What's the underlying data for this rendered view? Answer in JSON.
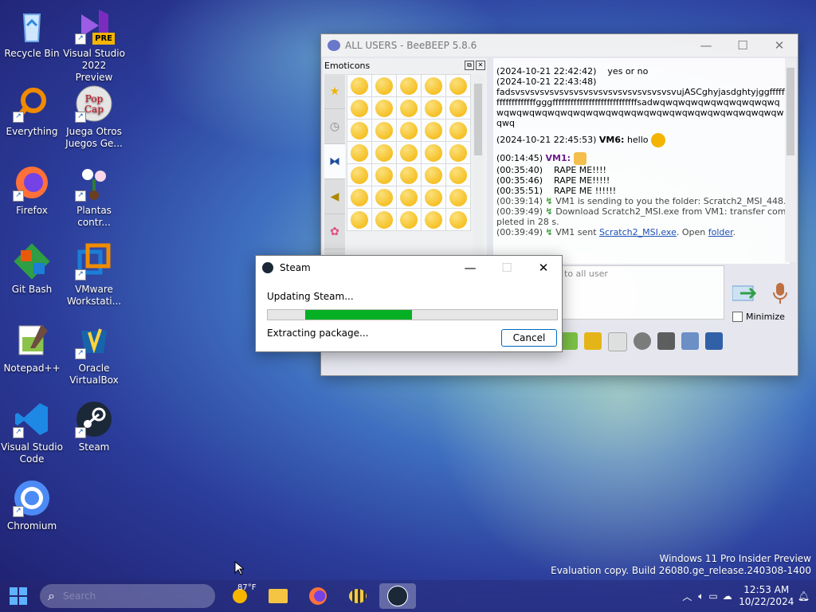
{
  "desktop": {
    "icons": [
      {
        "label": "Recycle Bin"
      },
      {
        "label": "Visual Studio 2022 Preview",
        "badge": "PRE"
      },
      {
        "label": "Everything"
      },
      {
        "label": "Juega Otros Juegos Ge..."
      },
      {
        "label": "Firefox"
      },
      {
        "label": "Plantas contr..."
      },
      {
        "label": "Git Bash"
      },
      {
        "label": "VMware Workstati..."
      },
      {
        "label": "Notepad++"
      },
      {
        "label": "Oracle VirtualBox"
      },
      {
        "label": "Visual Studio Code"
      },
      {
        "label": "Steam"
      },
      {
        "label": "Chromium"
      }
    ]
  },
  "beebeep": {
    "title": "ALL USERS - BeeBEEP 5.8.6",
    "emoticons_title": "Emoticons",
    "chat": [
      {
        "time": "(2024-10-21 22:42:42)",
        "text": "yes or no"
      },
      {
        "time": "(2024-10-21 22:43:48)",
        "text": "fadsvsvsvsvsvsvsvsvsvsvsvsvsvsvsvsvsvujASCghyjasdghtyjggffffffffffffffffffgggffffffffffffffffffffffffffffsadwqwqwqwqwqwqwqwqwqwqwqwqwqwqwqwqwqwqwqwqwqwqwqwqwqwqwqwqwqwqwqwqwqwq"
      },
      {
        "time": "(2024-10-21 22:45:53)",
        "user": "VM6:",
        "text": "hello"
      },
      {
        "time": "(00:14:45)",
        "user": "VM1:",
        "text": ""
      },
      {
        "time": "(00:35:40)",
        "text": "RAPE ME!!!!"
      },
      {
        "time": "(00:35:46)",
        "text": "RAPE ME!!!!!"
      },
      {
        "time": "(00:35:51)",
        "text": "RAPE ME !!!!!!"
      },
      {
        "time": "(00:39:14)",
        "text": "VM1 is sending to you the folder: Scratch2_MSI_448."
      },
      {
        "time": "(00:39:49)",
        "text": "Download Scratch2_MSI.exe from VM1: transfer completed in 28 s."
      },
      {
        "time": "(00:39:49)",
        "text_before": "VM1 sent ",
        "link1": "Scratch2_MSI.exe",
        "text_mid": ". Open ",
        "link2": "folder",
        "text_after": "."
      }
    ],
    "input_placeholder": "to all user",
    "minimize_label": "Minimize"
  },
  "steam_dialog": {
    "title": "Steam",
    "status": "Updating Steam...",
    "progress_start_fraction": 0.13,
    "progress_end_fraction": 0.5,
    "status_detail": "Extracting package...",
    "cancel_label": "Cancel"
  },
  "watermark": {
    "line1": "Windows 11 Pro Insider Preview",
    "line2": "Evaluation copy. Build 26080.ge_release.240308-1400"
  },
  "taskbar": {
    "search_placeholder": "Search",
    "weather": "87°F",
    "time": "12:53 AM",
    "date": "10/22/2024"
  }
}
